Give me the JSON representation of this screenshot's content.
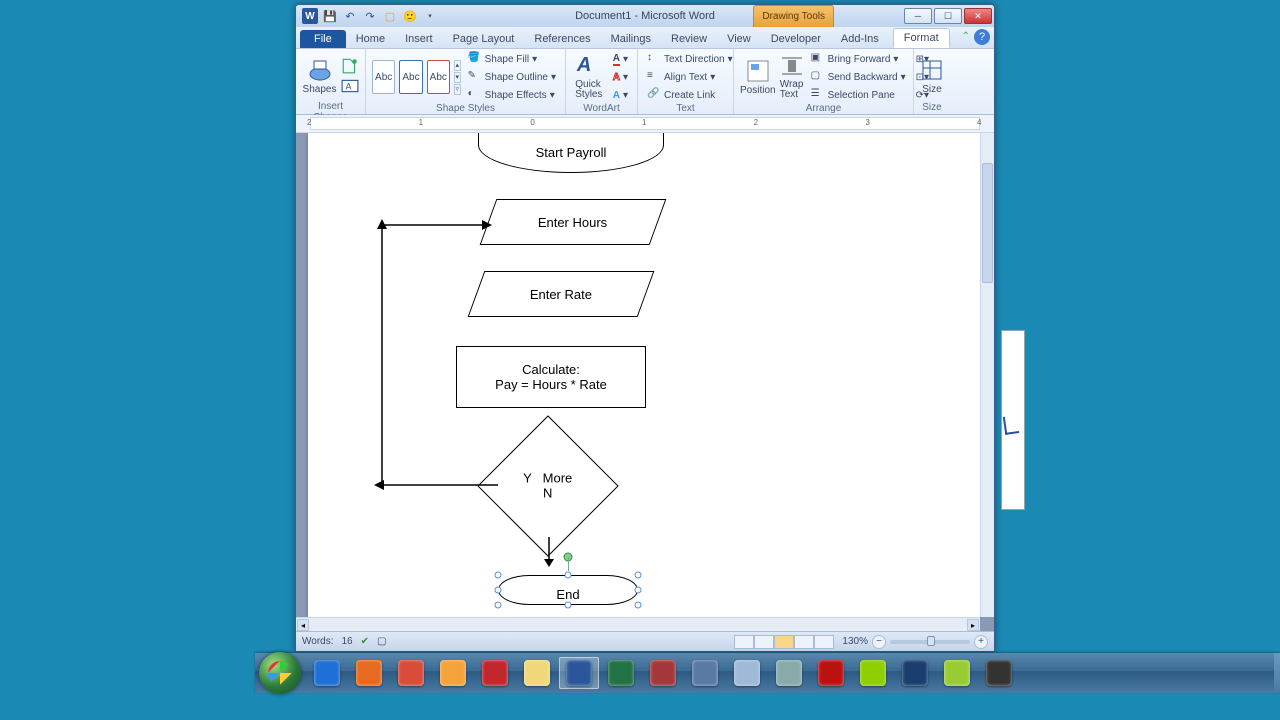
{
  "titlebar": {
    "title": "Document1 - Microsoft Word",
    "context_tab": "Drawing Tools"
  },
  "tabs": {
    "file": "File",
    "home": "Home",
    "insert": "Insert",
    "pagelayout": "Page Layout",
    "references": "References",
    "mailings": "Mailings",
    "review": "Review",
    "view": "View",
    "developer": "Developer",
    "addins": "Add-Ins",
    "format": "Format"
  },
  "ribbon": {
    "insert_shapes": {
      "label": "Insert Shapes",
      "shapes_btn": "Shapes"
    },
    "shape_styles": {
      "label": "Shape Styles",
      "abc": "Abc",
      "fill": "Shape Fill",
      "outline": "Shape Outline",
      "effects": "Shape Effects"
    },
    "wordart": {
      "label": "WordArt Sty…",
      "quick": "Quick\nStyles"
    },
    "text": {
      "label": "Text",
      "direction": "Text Direction",
      "align": "Align Text",
      "create_link": "Create Link"
    },
    "arrange": {
      "label": "Arrange",
      "position": "Position",
      "wrap": "Wrap\nText",
      "bring_forward": "Bring Forward",
      "send_backward": "Send Backward",
      "selection_pane": "Selection Pane"
    },
    "size": {
      "label": "Size",
      "btn": "Size"
    }
  },
  "ruler": {
    "ticks": [
      "-2",
      "-1",
      "0",
      "1",
      "2",
      "3",
      "4"
    ]
  },
  "flowchart": {
    "start": "Start Payroll",
    "enter_hours": "Enter Hours",
    "enter_rate": "Enter Rate",
    "calc_title": "Calculate:",
    "calc_formula": "Pay = Hours * Rate",
    "decision_y": "Y",
    "decision_more": "More",
    "decision_n": "N",
    "end_label": "End"
  },
  "status": {
    "words_label": "Words:",
    "words_count": "16",
    "zoom": "130%"
  },
  "taskbar_items": [
    {
      "name": "ie",
      "color": "#1e6fd6"
    },
    {
      "name": "firefox",
      "color": "#e66a1f"
    },
    {
      "name": "chrome",
      "color": "#d94b3a"
    },
    {
      "name": "outlook",
      "color": "#f3a33a"
    },
    {
      "name": "opera",
      "color": "#c1272d"
    },
    {
      "name": "explorer",
      "color": "#f0d87a"
    },
    {
      "name": "word",
      "color": "#2b579a"
    },
    {
      "name": "excel",
      "color": "#217346"
    },
    {
      "name": "access",
      "color": "#a4373a"
    },
    {
      "name": "app1",
      "color": "#5a7aa6"
    },
    {
      "name": "notepad",
      "color": "#9fb9d8"
    },
    {
      "name": "snip",
      "color": "#8aa"
    },
    {
      "name": "adobe-reader",
      "color": "#b11"
    },
    {
      "name": "dreamweaver",
      "color": "#8fce00"
    },
    {
      "name": "photoshop",
      "color": "#1a3e6e"
    },
    {
      "name": "app2",
      "color": "#9c3"
    },
    {
      "name": "movie-maker",
      "color": "#333"
    }
  ]
}
